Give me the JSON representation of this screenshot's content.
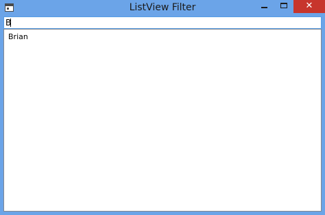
{
  "window": {
    "title": "ListView Filter",
    "close_glyph": "✕"
  },
  "filter": {
    "value": "B"
  },
  "list": {
    "items": [
      "Brian"
    ]
  }
}
